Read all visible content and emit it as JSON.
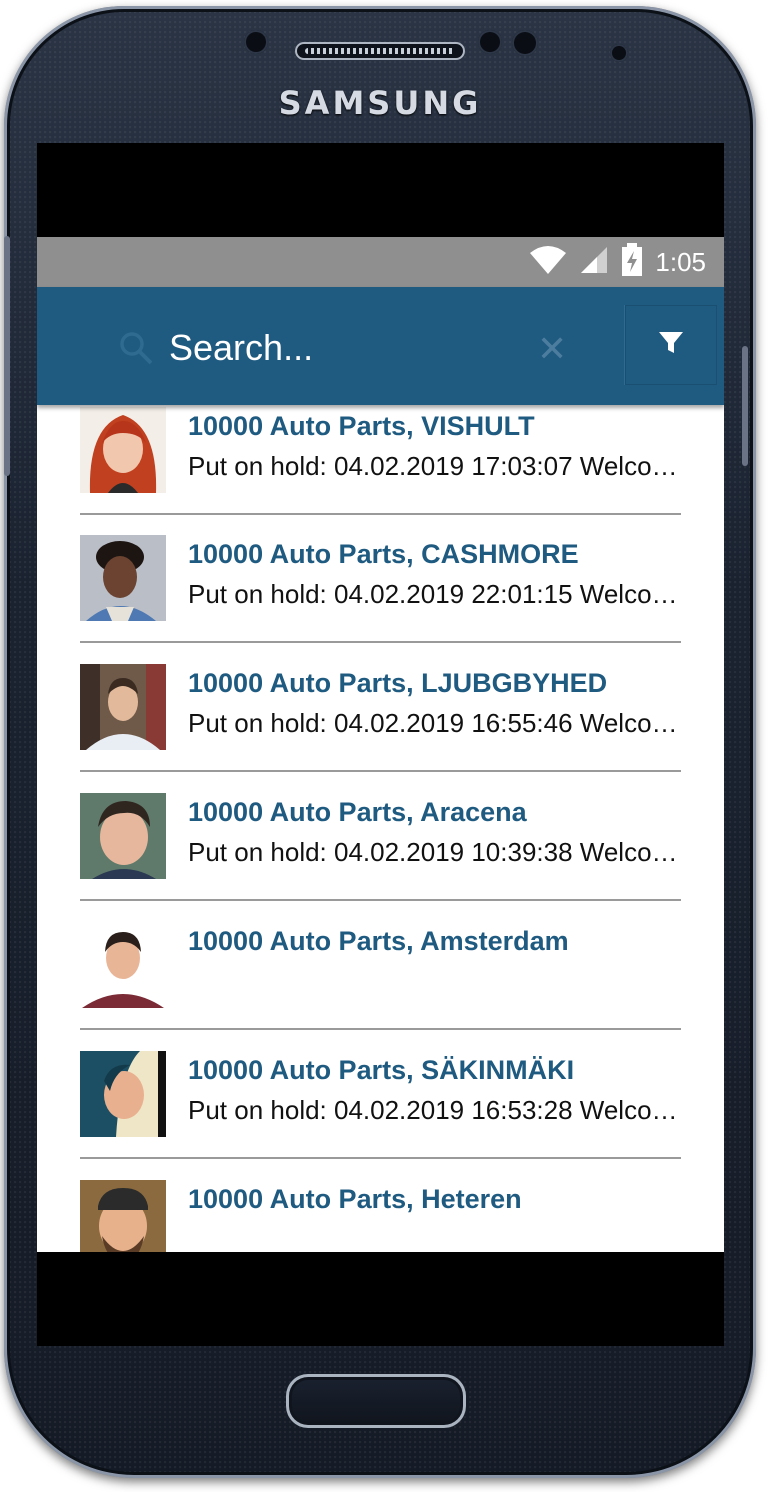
{
  "device": {
    "brand": "SAMSUNG"
  },
  "status_bar": {
    "time": "1:05"
  },
  "search": {
    "placeholder": "Search..."
  },
  "contacts": [
    {
      "title": "10000 Auto Parts, VISHULT",
      "subtitle": "Put on hold: 04.02.2019 17:03:07 Welcome"
    },
    {
      "title": "10000 Auto Parts, CASHMORE",
      "subtitle": "Put on hold: 04.02.2019 22:01:15 Welcome"
    },
    {
      "title": "10000 Auto Parts, LJUBGBYHED",
      "subtitle": "Put on hold: 04.02.2019 16:55:46 Welcome"
    },
    {
      "title": "10000 Auto Parts, Aracena",
      "subtitle": "Put on hold: 04.02.2019 10:39:38 Welcome"
    },
    {
      "title": "10000 Auto Parts, Amsterdam",
      "subtitle": ""
    },
    {
      "title": "10000 Auto Parts, SÄKINMÄKI",
      "subtitle": "Put on hold: 04.02.2019 16:53:28 Welcome"
    },
    {
      "title": "10000 Auto Parts, Heteren",
      "subtitle": ""
    }
  ],
  "colors": {
    "app_bar": "#1f5a80",
    "title_text": "#1f5a80",
    "status_bar": "#8f8f8f"
  }
}
